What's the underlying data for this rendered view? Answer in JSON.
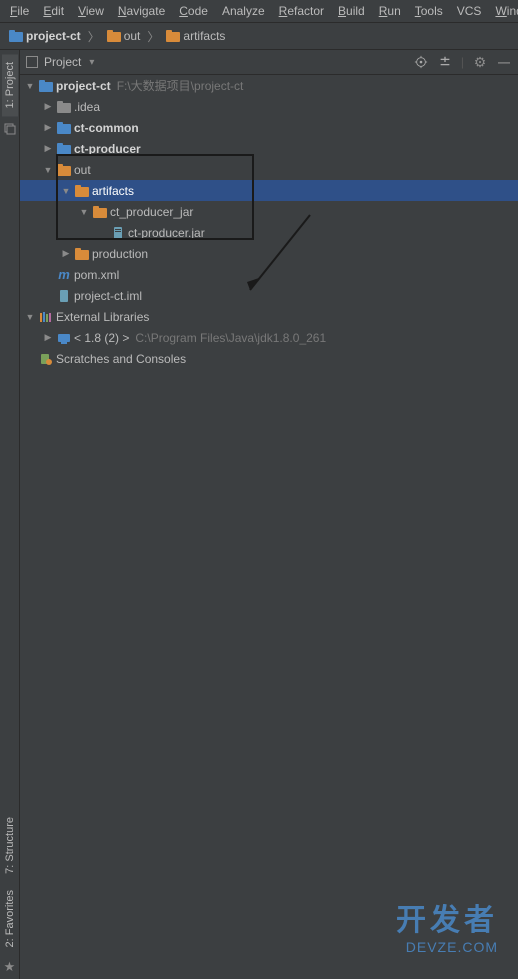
{
  "menubar": {
    "items": [
      "File",
      "Edit",
      "View",
      "Navigate",
      "Code",
      "Analyze",
      "Refactor",
      "Build",
      "Run",
      "Tools",
      "VCS",
      "Window"
    ],
    "underlines": [
      "F",
      "E",
      "V",
      "N",
      "C",
      "",
      "R",
      "B",
      "R",
      "T",
      "",
      "W"
    ]
  },
  "breadcrumb": {
    "items": [
      {
        "label": "project-ct",
        "icon": "folder-blue",
        "bold": true
      },
      {
        "label": "out",
        "icon": "folder-orange"
      },
      {
        "label": "artifacts",
        "icon": "folder-orange"
      }
    ]
  },
  "toolbar": {
    "project_label": "Project"
  },
  "sidebar": {
    "tabs": [
      {
        "label": "1: Project",
        "active": true
      },
      {
        "label": "7: Structure",
        "active": false
      },
      {
        "label": "2: Favorites",
        "active": false
      }
    ]
  },
  "tree": [
    {
      "level": 0,
      "arrow": "down",
      "icon": "folder-blue",
      "label": "project-ct",
      "bold": true,
      "path": "F:\\大数据项目\\project-ct"
    },
    {
      "level": 1,
      "arrow": "right",
      "icon": "folder-gray",
      "label": ".idea"
    },
    {
      "level": 1,
      "arrow": "right",
      "icon": "folder-blue",
      "label": "ct-common",
      "bold": true
    },
    {
      "level": 1,
      "arrow": "right",
      "icon": "folder-blue",
      "label": "ct-producer",
      "bold": true
    },
    {
      "level": 1,
      "arrow": "down",
      "icon": "folder-orange",
      "label": "out"
    },
    {
      "level": 2,
      "arrow": "down",
      "icon": "folder-orange",
      "label": "artifacts",
      "selected": true
    },
    {
      "level": 3,
      "arrow": "down",
      "icon": "folder-orange",
      "label": "ct_producer_jar"
    },
    {
      "level": 4,
      "arrow": "",
      "icon": "jar",
      "label": "ct-producer.jar"
    },
    {
      "level": 2,
      "arrow": "right",
      "icon": "folder-orange",
      "label": "production"
    },
    {
      "level": 1,
      "arrow": "",
      "icon": "maven",
      "label": "pom.xml"
    },
    {
      "level": 1,
      "arrow": "",
      "icon": "file",
      "label": "project-ct.iml"
    },
    {
      "level": 0,
      "arrow": "down",
      "icon": "libraries",
      "label": "External Libraries"
    },
    {
      "level": 1,
      "arrow": "right",
      "icon": "jdk",
      "label": "< 1.8 (2) >",
      "path": "C:\\Program Files\\Java\\jdk1.8.0_261"
    },
    {
      "level": 0,
      "arrow": "",
      "icon": "scratch",
      "label": "Scratches and Consoles"
    }
  ],
  "watermark": {
    "top": "开发者",
    "bottom": "DEVZE.COM"
  }
}
